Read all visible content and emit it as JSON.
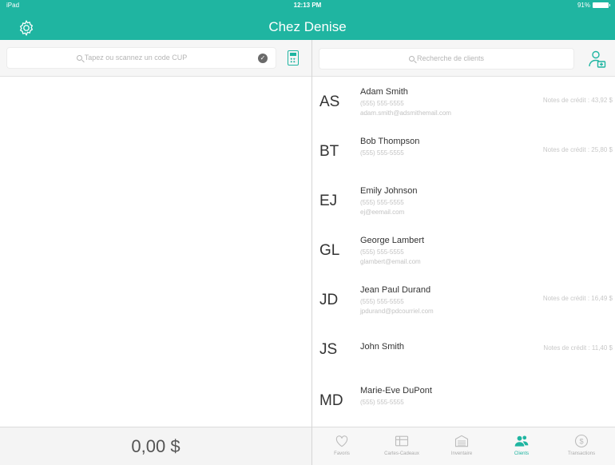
{
  "status_bar": {
    "carrier": "iPad",
    "time": "12:13 PM",
    "battery": "91%"
  },
  "header": {
    "title": "Chez Denise"
  },
  "left": {
    "scan_placeholder": "Tapez ou scannez un code CUP",
    "total": "0,00 $"
  },
  "right": {
    "search_placeholder": "Recherche de clients",
    "clients": [
      {
        "initials": "AS",
        "name": "Adam Smith",
        "phone": "(555) 555-5555",
        "email": "adam.smith@adsmithemail.com",
        "credit": "Notes de crédit : 43,92 $"
      },
      {
        "initials": "BT",
        "name": "Bob Thompson",
        "phone": "(555) 555-5555",
        "email": "",
        "credit": "Notes de crédit : 25,80 $"
      },
      {
        "initials": "EJ",
        "name": "Emily Johnson",
        "phone": "(555) 555-5555",
        "email": "ej@eemail.com",
        "credit": ""
      },
      {
        "initials": "GL",
        "name": "George Lambert",
        "phone": "(555) 555-5555",
        "email": "glambert@email.com",
        "credit": ""
      },
      {
        "initials": "JD",
        "name": "Jean Paul Durand",
        "phone": "(555) 555-5555",
        "email": "jpdurand@pdcourriel.com",
        "credit": "Notes de crédit : 16,49 $"
      },
      {
        "initials": "JS",
        "name": "John Smith",
        "phone": "",
        "email": "",
        "credit": "Notes de crédit : 11,40 $"
      },
      {
        "initials": "MD",
        "name": "Marie-Eve DuPont",
        "phone": "(555) 555-5555",
        "email": "",
        "credit": ""
      }
    ]
  },
  "tabs": [
    {
      "label": "Favoris",
      "icon": "heart-icon"
    },
    {
      "label": "Cartes-Cadeaux",
      "icon": "gift-card-icon"
    },
    {
      "label": "Inventaire",
      "icon": "inventory-icon"
    },
    {
      "label": "Clients",
      "icon": "clients-icon",
      "active": true
    },
    {
      "label": "Transactions",
      "icon": "dollar-icon"
    }
  ],
  "colors": {
    "accent": "#1fb5a1"
  }
}
